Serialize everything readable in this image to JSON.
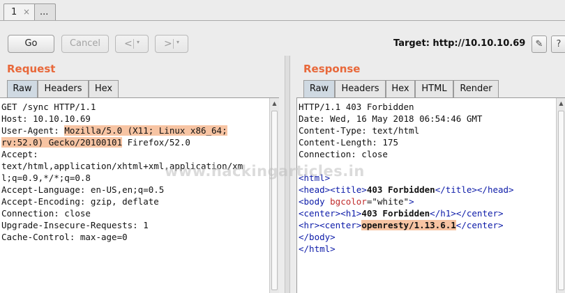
{
  "tabs": [
    {
      "label": "1",
      "close": "×"
    },
    {
      "label": "..."
    }
  ],
  "toolbar": {
    "go_label": "Go",
    "cancel_label": "Cancel",
    "back_arrow": "<",
    "forward_arrow": ">",
    "dropdown_glyph": "▾",
    "target_text": "Target: http://10.10.10.69",
    "edit_icon": "✎",
    "help_icon": "?"
  },
  "request": {
    "title": "Request",
    "tabs": [
      "Raw",
      "Headers",
      "Hex"
    ],
    "lines": [
      [
        {
          "t": "GET /sync HTTP/1.1"
        }
      ],
      [
        {
          "t": "Host: 10.10.10.69"
        }
      ],
      [
        {
          "t": "User-Agent: "
        },
        {
          "t": "Mozilla/5.0 (X11; Linux x86_64;",
          "c": "hl"
        }
      ],
      [
        {
          "t": "rv:52.0) Gecko/20100101",
          "c": "hl"
        },
        {
          "t": " Firefox/52.0"
        }
      ],
      [
        {
          "t": "Accept:"
        }
      ],
      [
        {
          "t": "text/html,application/xhtml+xml,application/xm"
        }
      ],
      [
        {
          "t": "l;q=0.9,*/*;q=0.8"
        }
      ],
      [
        {
          "t": "Accept-Language: en-US,en;q=0.5"
        }
      ],
      [
        {
          "t": "Accept-Encoding: gzip, deflate"
        }
      ],
      [
        {
          "t": "Connection: close"
        }
      ],
      [
        {
          "t": "Upgrade-Insecure-Requests: 1"
        }
      ],
      [
        {
          "t": "Cache-Control: max-age=0"
        }
      ]
    ]
  },
  "response": {
    "title": "Response",
    "tabs": [
      "Raw",
      "Headers",
      "Hex",
      "HTML",
      "Render"
    ],
    "lines": [
      [
        {
          "t": "HTTP/1.1 403 Forbidden"
        }
      ],
      [
        {
          "t": "Date: Wed, 16 May 2018 06:54:46 GMT"
        }
      ],
      [
        {
          "t": "Content-Type: text/html"
        }
      ],
      [
        {
          "t": "Content-Length: 175"
        }
      ],
      [
        {
          "t": "Connection: close"
        }
      ],
      [
        {
          "t": ""
        }
      ],
      [
        {
          "t": "<html>",
          "c": "tag"
        }
      ],
      [
        {
          "t": "<head>",
          "c": "tag"
        },
        {
          "t": "<title>",
          "c": "tag"
        },
        {
          "t": "403 Forbidden",
          "c": "bold"
        },
        {
          "t": "</title>",
          "c": "tag"
        },
        {
          "t": "</head>",
          "c": "tag"
        }
      ],
      [
        {
          "t": "<body ",
          "c": "tag"
        },
        {
          "t": "bgcolor",
          "c": "attr"
        },
        {
          "t": "=\"white\""
        },
        {
          "t": ">",
          "c": "tag"
        }
      ],
      [
        {
          "t": "<center>",
          "c": "tag"
        },
        {
          "t": "<h1>",
          "c": "tag"
        },
        {
          "t": "403 Forbidden",
          "c": "bold"
        },
        {
          "t": "</h1>",
          "c": "tag"
        },
        {
          "t": "</center>",
          "c": "tag"
        }
      ],
      [
        {
          "t": "<hr>",
          "c": "tag"
        },
        {
          "t": "<center>",
          "c": "tag"
        },
        {
          "t": "openresty/1.13.6.1",
          "c": "bold hl"
        },
        {
          "t": "</center>",
          "c": "tag"
        }
      ],
      [
        {
          "t": "</body>",
          "c": "tag"
        }
      ],
      [
        {
          "t": "</html>",
          "c": "tag"
        }
      ]
    ]
  },
  "watermark": "www.hackingarticles.in",
  "colors": {
    "accent": "#e8683a",
    "highlight": "#f7c4a3",
    "tag": "#0b1aa8",
    "attr": "#c02c2c"
  }
}
